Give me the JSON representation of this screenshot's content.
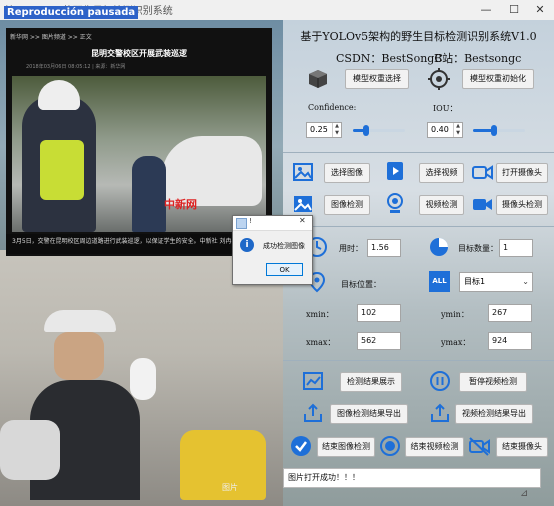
{
  "window": {
    "title": "Reproducción pausada",
    "underlay_title": "基于YOLOv5的野生目标检测识别系统",
    "controls": {
      "minimize": "—",
      "maximize": "☐",
      "close": "✕"
    }
  },
  "left_panel": {
    "news": {
      "breadcrumb": "新华网  >>  图片频道  >>  正文",
      "headline": "昆明交警校区开展武装巡逻",
      "meta": "2018年03月06日 08:05:12 | 来源：新华网",
      "photo_watermark": "中新网",
      "caption": "3月5日，交警在昆明校区周边道路进行武装巡逻，以保证学生的安全。中新社 刘冉"
    },
    "bottom_watermark": "图片"
  },
  "right_panel": {
    "title": "基于YOLOv5架构的野生目标检测识别系统V1.0",
    "csdn_label": "CSDN：BestSongC",
    "bstation_label": "B站：Bestsongc",
    "btn_model_select": "模型权重选择",
    "btn_model_init": "模型权重初始化",
    "confidence_label": "Confidence:",
    "confidence_value": "0.25",
    "iou_label": "IOU：",
    "iou_value": "0.40",
    "btn_select_image": "选择图像",
    "btn_select_video": "选择视频",
    "btn_open_camera": "打开摄像头",
    "btn_image_detect": "图像检测",
    "btn_video_detect": "视频检测",
    "btn_camera_detect": "摄像头检测",
    "time_label": "用时：",
    "time_value": "1.56",
    "count_label": "目标数量：",
    "count_value": "1",
    "position_label": "目标位置：",
    "target_select": "目标1",
    "xmin_label": "xmin：",
    "xmin_value": "102",
    "ymin_label": "ymin：",
    "ymin_value": "267",
    "xmax_label": "xmax：",
    "xmax_value": "562",
    "ymax_label": "ymax：",
    "ymax_value": "924",
    "btn_show_result": "检测结果展示",
    "btn_pause_video": "暂停视频检测",
    "btn_export_image": "图像检测结果导出",
    "btn_export_video": "视频检测结果导出",
    "btn_end_image": "结束图像检测",
    "btn_end_video": "结束视频检测",
    "btn_end_camera": "结束摄像头",
    "status": "图片打开成功！！！"
  },
  "dialog": {
    "title": "!",
    "message": "成功检测图像",
    "ok": "OK"
  },
  "values": {
    "confidence": 0.25,
    "iou": 0.4
  },
  "colors": {
    "accent": "#1e6fd8",
    "dialog_border": "#0078d7"
  }
}
